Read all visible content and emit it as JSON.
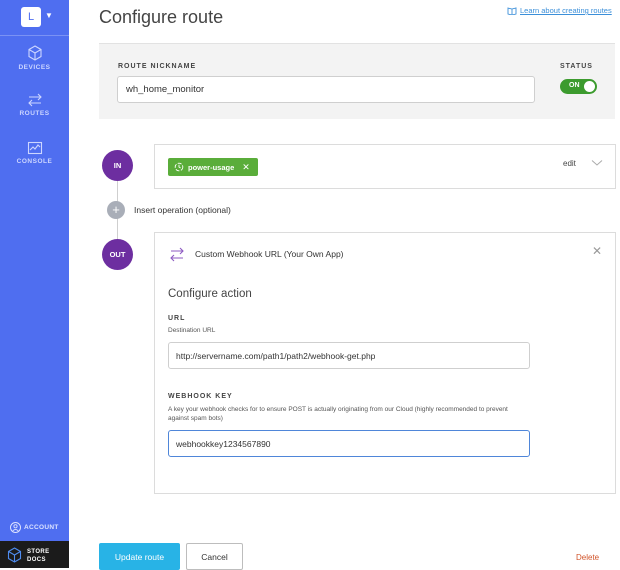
{
  "sidebar": {
    "org_initial": "L",
    "nav": [
      {
        "label": "DEVICES",
        "icon": "cube-icon"
      },
      {
        "label": "ROUTES",
        "icon": "routes-icon"
      },
      {
        "label": "CONSOLE",
        "icon": "console-icon"
      }
    ],
    "account_label": "ACCOUNT",
    "store_label": "STORE",
    "docs_label": "DOCS"
  },
  "header": {
    "title": "Configure route",
    "learn_link": "Learn about creating routes"
  },
  "nickname": {
    "label": "ROUTE NICKNAME",
    "value": "wh_home_monitor"
  },
  "status": {
    "label": "STATUS",
    "toggle_label": "ON",
    "enabled": true
  },
  "flow": {
    "in_label": "IN",
    "out_label": "OUT",
    "in_tag": "power-usage",
    "edit_label": "edit",
    "insert_label": "Insert operation (optional)"
  },
  "action": {
    "title": "Custom Webhook URL (Your Own App)",
    "section_title": "Configure action",
    "url_label": "URL",
    "url_sub": "Destination URL",
    "url_value": "http://servername.com/path1/path2/webhook-get.php",
    "key_label": "WEBHOOK KEY",
    "key_sub": "A key your webhook checks for to ensure POST is actually originating from our Cloud (highly recommended to prevent against spam bots)",
    "key_value": "webhookkey1234567890"
  },
  "footer": {
    "update_label": "Update route",
    "cancel_label": "Cancel",
    "delete_label": "Delete"
  },
  "colors": {
    "sidebar": "#4f6ef0",
    "accent": "#28b3e6",
    "flow_node": "#6d2ea0",
    "tag": "#5aad3a",
    "toggle_on": "#3c9b2e",
    "delete": "#d1542a"
  }
}
